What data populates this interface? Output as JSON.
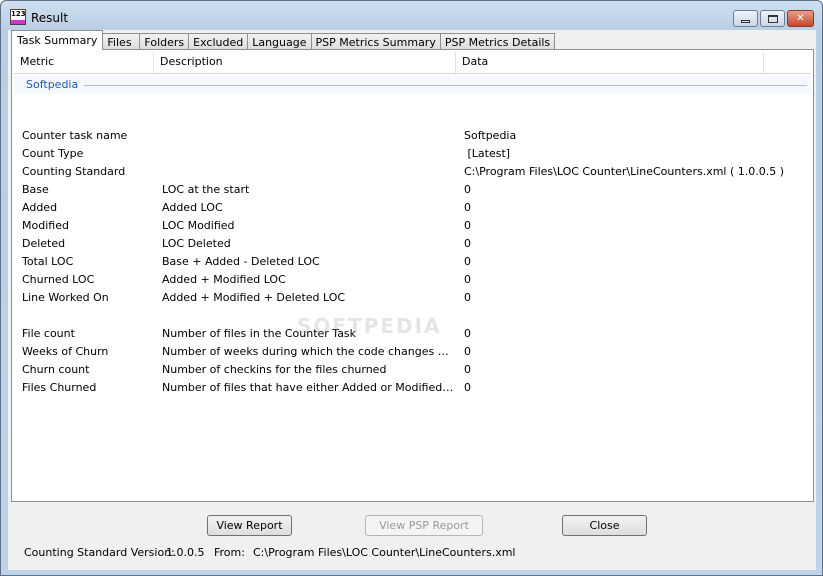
{
  "window": {
    "title": "Result",
    "icon_text": "123"
  },
  "tabs": [
    {
      "label": "Task Summary"
    },
    {
      "label": "Files"
    },
    {
      "label": "Folders"
    },
    {
      "label": "Excluded"
    },
    {
      "label": "Language"
    },
    {
      "label": "PSP Metrics Summary"
    },
    {
      "label": "PSP Metrics Details"
    }
  ],
  "grid": {
    "columns": [
      "Metric",
      "Description",
      "Data"
    ],
    "group": "Softpedia",
    "rows": [
      {
        "metric": "Counter task name",
        "description": "",
        "data": "Softpedia"
      },
      {
        "metric": "Count Type",
        "description": "",
        "data": " [Latest]"
      },
      {
        "metric": "Counting Standard",
        "description": "",
        "data": "C:\\Program Files\\LOC Counter\\LineCounters.xml ( 1.0.0.5 )"
      },
      {
        "metric": "Base",
        "description": "LOC at the start",
        "data": "0"
      },
      {
        "metric": "Added",
        "description": "Added LOC",
        "data": "0"
      },
      {
        "metric": "Modified",
        "description": "LOC Modified",
        "data": "0"
      },
      {
        "metric": "Deleted",
        "description": "LOC Deleted",
        "data": "0"
      },
      {
        "metric": "Total LOC",
        "description": "Base + Added - Deleted LOC",
        "data": "0"
      },
      {
        "metric": "Churned LOC",
        "description": "Added + Modified LOC",
        "data": "0"
      },
      {
        "metric": "Line Worked On",
        "description": "Added + Modified + Deleted LOC",
        "data": "0"
      },
      {
        "metric": "",
        "description": "",
        "data": ""
      },
      {
        "metric": "File count",
        "description": "Number of files in the Counter Task",
        "data": "0"
      },
      {
        "metric": "Weeks of Churn",
        "description": "Number of weeks during which the code changes occurred",
        "data": "0"
      },
      {
        "metric": "Churn count",
        "description": "Number of checkins for the files churned",
        "data": "0"
      },
      {
        "metric": "Files Churned",
        "description": "Number of files that have either Added or Modified or Deleted LOC",
        "data": "0"
      }
    ]
  },
  "watermark": "SOFTPEDIA",
  "buttons": {
    "view_report": "View Report",
    "view_psp_report": "View PSP Report",
    "close": "Close"
  },
  "status": {
    "version_label": "Counting Standard Version:",
    "version_value": "1.0.0.5",
    "from_label": "From:",
    "from_value": "C:\\Program Files\\LOC Counter\\LineCounters.xml"
  }
}
